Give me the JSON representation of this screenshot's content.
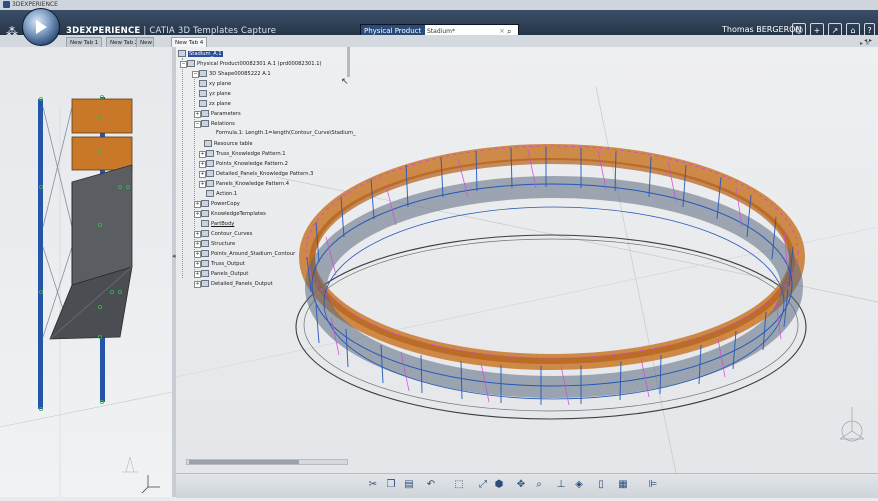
{
  "window": {
    "title": "3DEXPERIENCE"
  },
  "header": {
    "brand": "3DEXPERIENCE",
    "app_separator": " | ",
    "app_name": "CATIA 3D Templates Capture",
    "search": {
      "scope": "Physical Product",
      "value": "Stadium*"
    },
    "user": "Thomas BERGERON",
    "icons": [
      "user-icon",
      "plus-icon",
      "share-icon",
      "home-icon",
      "help-icon"
    ]
  },
  "tabs": [
    {
      "label": "New Tab 1"
    },
    {
      "label": "New Tab 2"
    },
    {
      "label": "New"
    },
    {
      "label": "New Tab 4",
      "active": true
    }
  ],
  "tree": [
    {
      "label": "Stadium_A.1",
      "selected": true
    },
    {
      "label": "Physical Product00082301 A.1 (prd00082301.1)"
    },
    {
      "label": "3D Shape00085222 A.1"
    },
    {
      "label": "xy plane"
    },
    {
      "label": "yz plane"
    },
    {
      "label": "zx plane"
    },
    {
      "label": "Parameters"
    },
    {
      "label": "Relations"
    },
    {
      "label": "Formula.1: Length.1=length(Contour_Curve\\Stadium_"
    },
    {
      "label": "Resource table"
    },
    {
      "label": "Truss_Knowledge Pattern.1"
    },
    {
      "label": "Points_Knowledge Pattern.2"
    },
    {
      "label": "Detailed_Panels_Knowledge Pattern.3"
    },
    {
      "label": "Panels_Knowledge Pattern.4"
    },
    {
      "label": "Action.1"
    },
    {
      "label": "PowerCopy"
    },
    {
      "label": "KnowledgeTemplates"
    },
    {
      "label": "PartBody"
    },
    {
      "label": "Contour_Curves"
    },
    {
      "label": "Structure"
    },
    {
      "label": "Points_Around_Stadium_Contour"
    },
    {
      "label": "Truss_Output"
    },
    {
      "label": "Panels_Output"
    },
    {
      "label": "Detailed_Panels_Output"
    }
  ],
  "colors": {
    "panel_orange": "#c9782a",
    "panel_dark": "#5a5e63",
    "truss_blue": "#2457b8",
    "truss_pink": "#d04bd8",
    "header_bg": "#2a3b52"
  },
  "toolbar": [
    "cut-icon",
    "copy-icon",
    "paste-icon",
    "undo-icon",
    "redo-icon",
    "select-icon",
    "fit-all-icon",
    "view-cube-icon",
    "pan-icon",
    "zoom-icon",
    "normal-view-icon",
    "isometric-icon",
    "hide-show-icon",
    "render-style-icon",
    "tree-toggle-icon"
  ]
}
